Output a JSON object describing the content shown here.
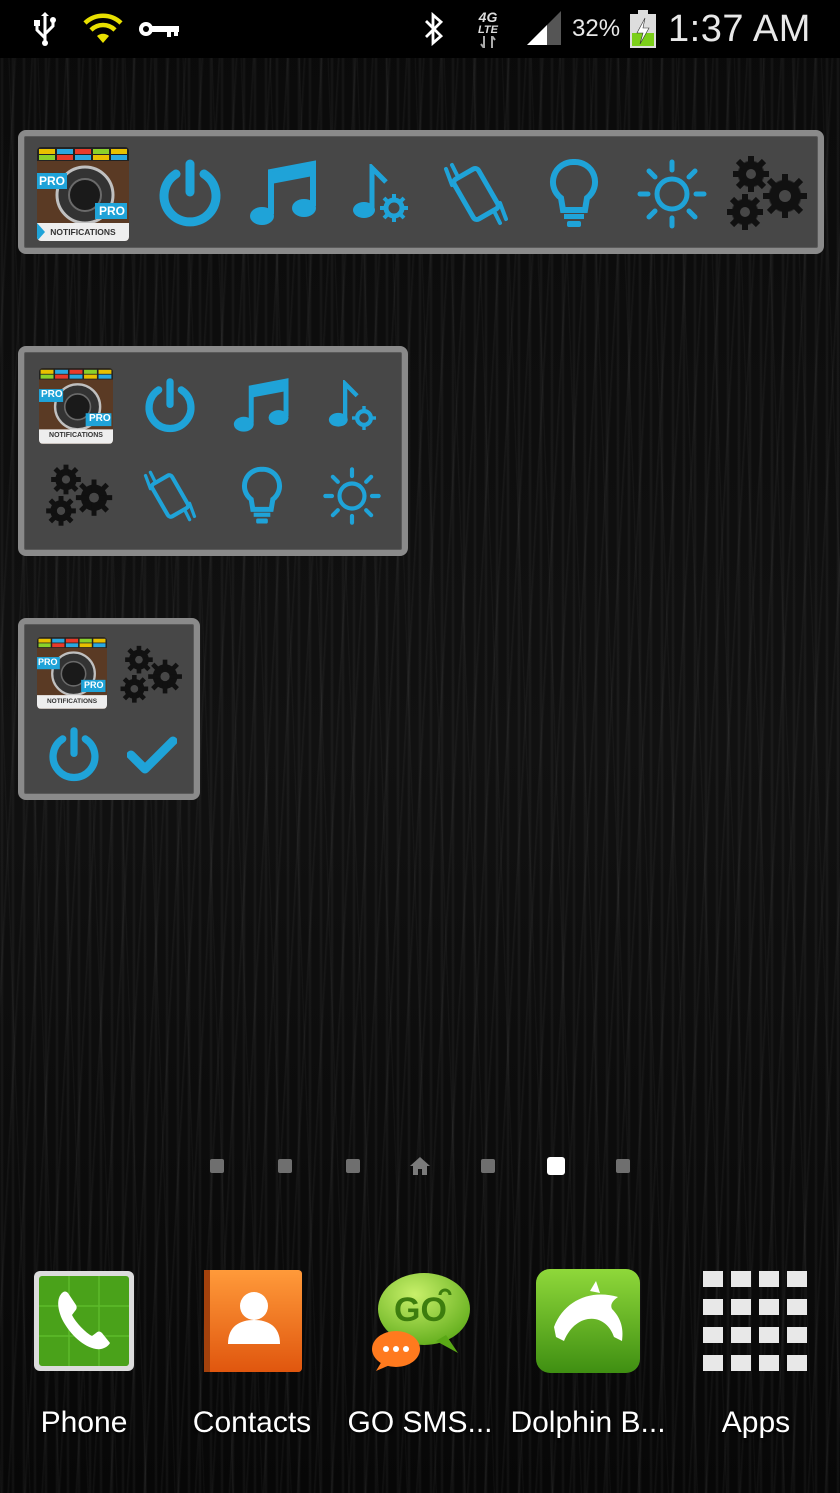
{
  "status_bar": {
    "icons": [
      "usb-icon",
      "wifi-icon",
      "key-icon",
      "bluetooth-icon",
      "4g-lte-icon",
      "signal-icon",
      "battery-charging-icon"
    ],
    "network_label_top": "4G",
    "network_label_bottom": "LTE",
    "battery_percent": "32%",
    "time": "1:37 AM"
  },
  "widgets": {
    "app_badge": {
      "top_text": "PRO",
      "bottom_text": "PRO",
      "label": "NOTIFICATIONS"
    },
    "accent_color": "#1fa3d8",
    "widget_large_icons": [
      "app-icon",
      "power-icon",
      "music-note-icon",
      "ringtone-settings-icon",
      "vibrate-icon",
      "flashlight-bulb-icon",
      "brightness-sun-icon",
      "settings-gears-icon"
    ],
    "widget_medium_icons": [
      "app-icon",
      "power-icon",
      "music-note-icon",
      "ringtone-settings-icon",
      "settings-gears-icon",
      "vibrate-icon",
      "flashlight-bulb-icon",
      "brightness-sun-icon"
    ],
    "widget_small_icons": [
      "app-icon",
      "settings-gears-icon",
      "power-icon",
      "checkmark-icon"
    ]
  },
  "pager": {
    "page_count": 7,
    "home_index": 3,
    "active_index": 5
  },
  "dock": [
    {
      "label": "Phone",
      "icon": "phone-icon"
    },
    {
      "label": "Contacts",
      "icon": "contacts-icon"
    },
    {
      "label": "GO SMS...",
      "icon": "go-sms-icon"
    },
    {
      "label": "Dolphin B...",
      "icon": "dolphin-browser-icon"
    },
    {
      "label": "Apps",
      "icon": "apps-grid-icon"
    }
  ]
}
